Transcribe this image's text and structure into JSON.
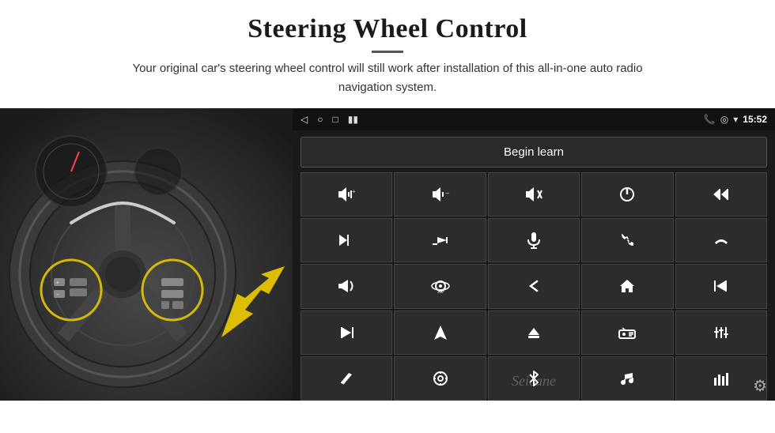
{
  "page": {
    "title": "Steering Wheel Control",
    "subtitle": "Your original car's steering wheel control will still work after installation of this all-in-one auto radio navigation system."
  },
  "status_bar": {
    "back_icon": "◁",
    "home_icon": "○",
    "recent_icon": "□",
    "signal_icon": "▮▮",
    "phone_icon": "📞",
    "location_icon": "⊙",
    "wifi_icon": "▾",
    "time": "15:52"
  },
  "begin_learn_label": "Begin learn",
  "controls": [
    {
      "icon": "🔊+",
      "name": "vol-up"
    },
    {
      "icon": "🔊−",
      "name": "vol-down"
    },
    {
      "icon": "🔇",
      "name": "mute"
    },
    {
      "icon": "⏻",
      "name": "power"
    },
    {
      "icon": "⏮",
      "name": "prev-track-right"
    },
    {
      "icon": "⏭",
      "name": "next-track"
    },
    {
      "icon": "⏩",
      "name": "fast-forward"
    },
    {
      "icon": "🎤",
      "name": "mic"
    },
    {
      "icon": "📞",
      "name": "call"
    },
    {
      "icon": "↩",
      "name": "hang-up"
    },
    {
      "icon": "🔔",
      "name": "horn"
    },
    {
      "icon": "360°",
      "name": "camera-360"
    },
    {
      "icon": "↺",
      "name": "back"
    },
    {
      "icon": "⌂",
      "name": "home"
    },
    {
      "icon": "⏮⏮",
      "name": "prev-prev"
    },
    {
      "icon": "⏭⏭",
      "name": "next-next"
    },
    {
      "icon": "▶",
      "name": "play-nav"
    },
    {
      "icon": "⊖",
      "name": "eject"
    },
    {
      "icon": "📻",
      "name": "radio"
    },
    {
      "icon": "⚙≡",
      "name": "equalizer"
    },
    {
      "icon": "✏",
      "name": "edit"
    },
    {
      "icon": "◎",
      "name": "target"
    },
    {
      "icon": "✱",
      "name": "bluetooth"
    },
    {
      "icon": "🎵",
      "name": "music"
    },
    {
      "icon": "▮▮▮",
      "name": "spectrum"
    }
  ],
  "watermark": "Seicane",
  "gear_icon": "⚙"
}
